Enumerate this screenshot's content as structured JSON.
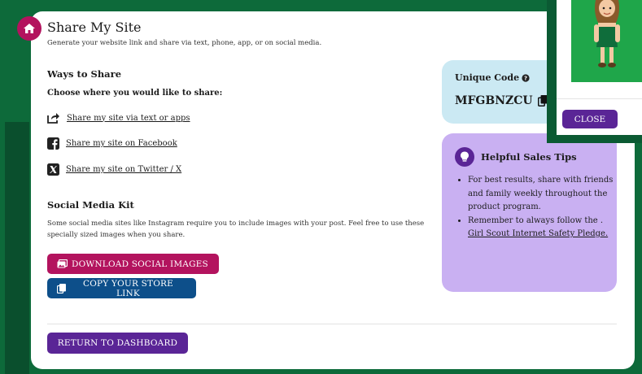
{
  "header": {
    "title": "Share My Site",
    "subtitle": "Generate your website link and share via text, phone, app, or on social media."
  },
  "ways": {
    "heading": "Ways to Share",
    "prompt": "Choose where you would like to share:",
    "options": [
      {
        "label": "Share my site via text or apps",
        "icon": "share-icon"
      },
      {
        "label": "Share my site on Facebook",
        "icon": "facebook-icon"
      },
      {
        "label": "Share my site on Twitter / X",
        "icon": "x-twitter-icon"
      }
    ]
  },
  "kit": {
    "heading": "Social Media Kit",
    "description": "Some social media sites like Instagram require you to include images with your post. Feel free to use these specially sized images when you share.",
    "download_label": "DOWNLOAD SOCIAL IMAGES",
    "copy_label": "COPY YOUR STORE LINK"
  },
  "footer": {
    "dashboard_label": "RETURN TO DASHBOARD"
  },
  "code": {
    "label": "Unique Code",
    "value": "MFGBNZCU"
  },
  "tips": {
    "heading": "Helpful Sales Tips",
    "item1": "For best results, share with friends and family weekly throughout the product program.",
    "item2_prefix": "Remember to always follow the .",
    "item2_link": "Girl Scout Internet Safety Pledge."
  },
  "popup": {
    "close_label": "CLOSE"
  },
  "colors": {
    "magenta": "#b3135e",
    "blue": "#0d4f8a",
    "purple": "#5a2596",
    "code_bg": "#cbe9f3",
    "tips_bg": "#c9b0f2",
    "page_bg": "#0b5a33"
  }
}
